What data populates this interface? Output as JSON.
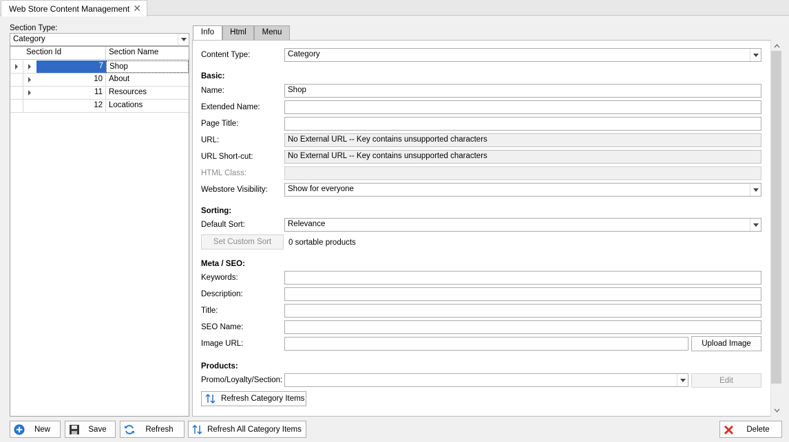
{
  "window": {
    "tab_title": "Web Store Content Management",
    "close_glyph": "✕"
  },
  "left": {
    "section_type_label": "Section Type:",
    "section_type_value": "Category",
    "grid": {
      "columns": [
        "Section Id",
        "Section Name"
      ],
      "rows": [
        {
          "id": "7",
          "name": "Shop",
          "expandable": true,
          "selected": true
        },
        {
          "id": "10",
          "name": "About",
          "expandable": true,
          "selected": false
        },
        {
          "id": "11",
          "name": "Resources",
          "expandable": true,
          "selected": false
        },
        {
          "id": "12",
          "name": "Locations",
          "expandable": false,
          "selected": false
        }
      ]
    }
  },
  "tabs": [
    "Info",
    "Html",
    "Menu"
  ],
  "info": {
    "content_type_label": "Content Type:",
    "content_type_value": "Category",
    "basic_header": "Basic:",
    "name_label": "Name:",
    "name_value": "Shop",
    "extended_name_label": "Extended Name:",
    "extended_name_value": "",
    "page_title_label": "Page Title:",
    "page_title_value": "",
    "url_label": "URL:",
    "url_value": "No External URL -- Key contains unsupported characters",
    "url_shortcut_label": "URL Short-cut:",
    "url_shortcut_value": "No External URL -- Key contains unsupported characters",
    "html_class_label": "HTML Class:",
    "html_class_value": "",
    "visibility_label": "Webstore Visibility:",
    "visibility_value": "Show for everyone",
    "sorting_header": "Sorting:",
    "default_sort_label": "Default Sort:",
    "default_sort_value": "Relevance",
    "custom_sort_button": "Set Custom Sort",
    "sortable_count": "0 sortable products",
    "meta_header": "Meta / SEO:",
    "keywords_label": "Keywords:",
    "description_label": "Description:",
    "title_label": "Title:",
    "seo_name_label": "SEO Name:",
    "image_url_label": "Image URL:",
    "upload_image_button": "Upload Image",
    "products_header": "Products:",
    "promo_label": "Promo/Loyalty/Section:",
    "promo_value": "",
    "edit_button": "Edit",
    "refresh_category_button": "Refresh Category Items"
  },
  "footer": {
    "new": "New",
    "save": "Save",
    "refresh": "Refresh",
    "refresh_all": "Refresh All Category Items",
    "delete": "Delete"
  },
  "colors": {
    "selection": "#316ac5",
    "accent_blue": "#1f6fc5",
    "delete_red": "#d9342b"
  },
  "icons": [
    "add-circle-icon",
    "floppy-disk-icon",
    "refresh-icon",
    "sort-arrows-icon",
    "delete-x-icon",
    "chevron-down-icon",
    "expand-arrow-icon",
    "close-icon"
  ]
}
